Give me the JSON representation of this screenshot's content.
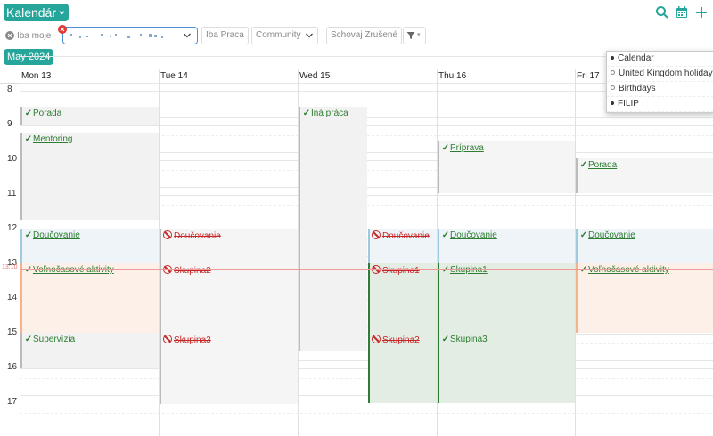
{
  "header": {
    "title": "Kalendár",
    "month_label": "May 2024"
  },
  "filters": {
    "only_mine": "Iba moje",
    "only_work": "Iba Praca",
    "community": "Community",
    "hide_cancelled": "Schovaj Zrušené"
  },
  "days": [
    "Mon 13",
    "Tue 14",
    "Wed 15",
    "Thu 16",
    "Fri 17"
  ],
  "hours": [
    "8",
    "9",
    "10",
    "11",
    "12",
    "13",
    "14",
    "15",
    "16",
    "17"
  ],
  "now_time": "13:10",
  "events": [
    {
      "title": "Porada"
    },
    {
      "title": "Mentoring"
    },
    {
      "title": "Doučovanie"
    },
    {
      "title": "Voľnočasové aktivity"
    },
    {
      "title": "Supervízia"
    },
    {
      "title": "Doučovanie"
    },
    {
      "title": "Skupina2"
    },
    {
      "title": "Skupina3"
    },
    {
      "title": "Iná práca"
    },
    {
      "title": "Doučovanie"
    },
    {
      "title": "Skupina1"
    },
    {
      "title": "Skupina2"
    },
    {
      "title": "Príprava"
    },
    {
      "title": "Doučovanie"
    },
    {
      "title": "Skupina1"
    },
    {
      "title": "Skupina3"
    },
    {
      "title": "Porada"
    },
    {
      "title": "Doučovanie"
    },
    {
      "title": "Voľnočasové aktivity"
    }
  ],
  "calendar_menu": [
    {
      "label": "Calendar",
      "selected": true
    },
    {
      "label": "United Kingdom holidays",
      "selected": false
    },
    {
      "label": "Birthdays",
      "selected": false
    },
    {
      "label": "FILIP",
      "selected": true
    }
  ],
  "colors": {
    "accent": "#26a69a",
    "confirmed": "#2e7d32",
    "cancelled": "#c62828"
  }
}
